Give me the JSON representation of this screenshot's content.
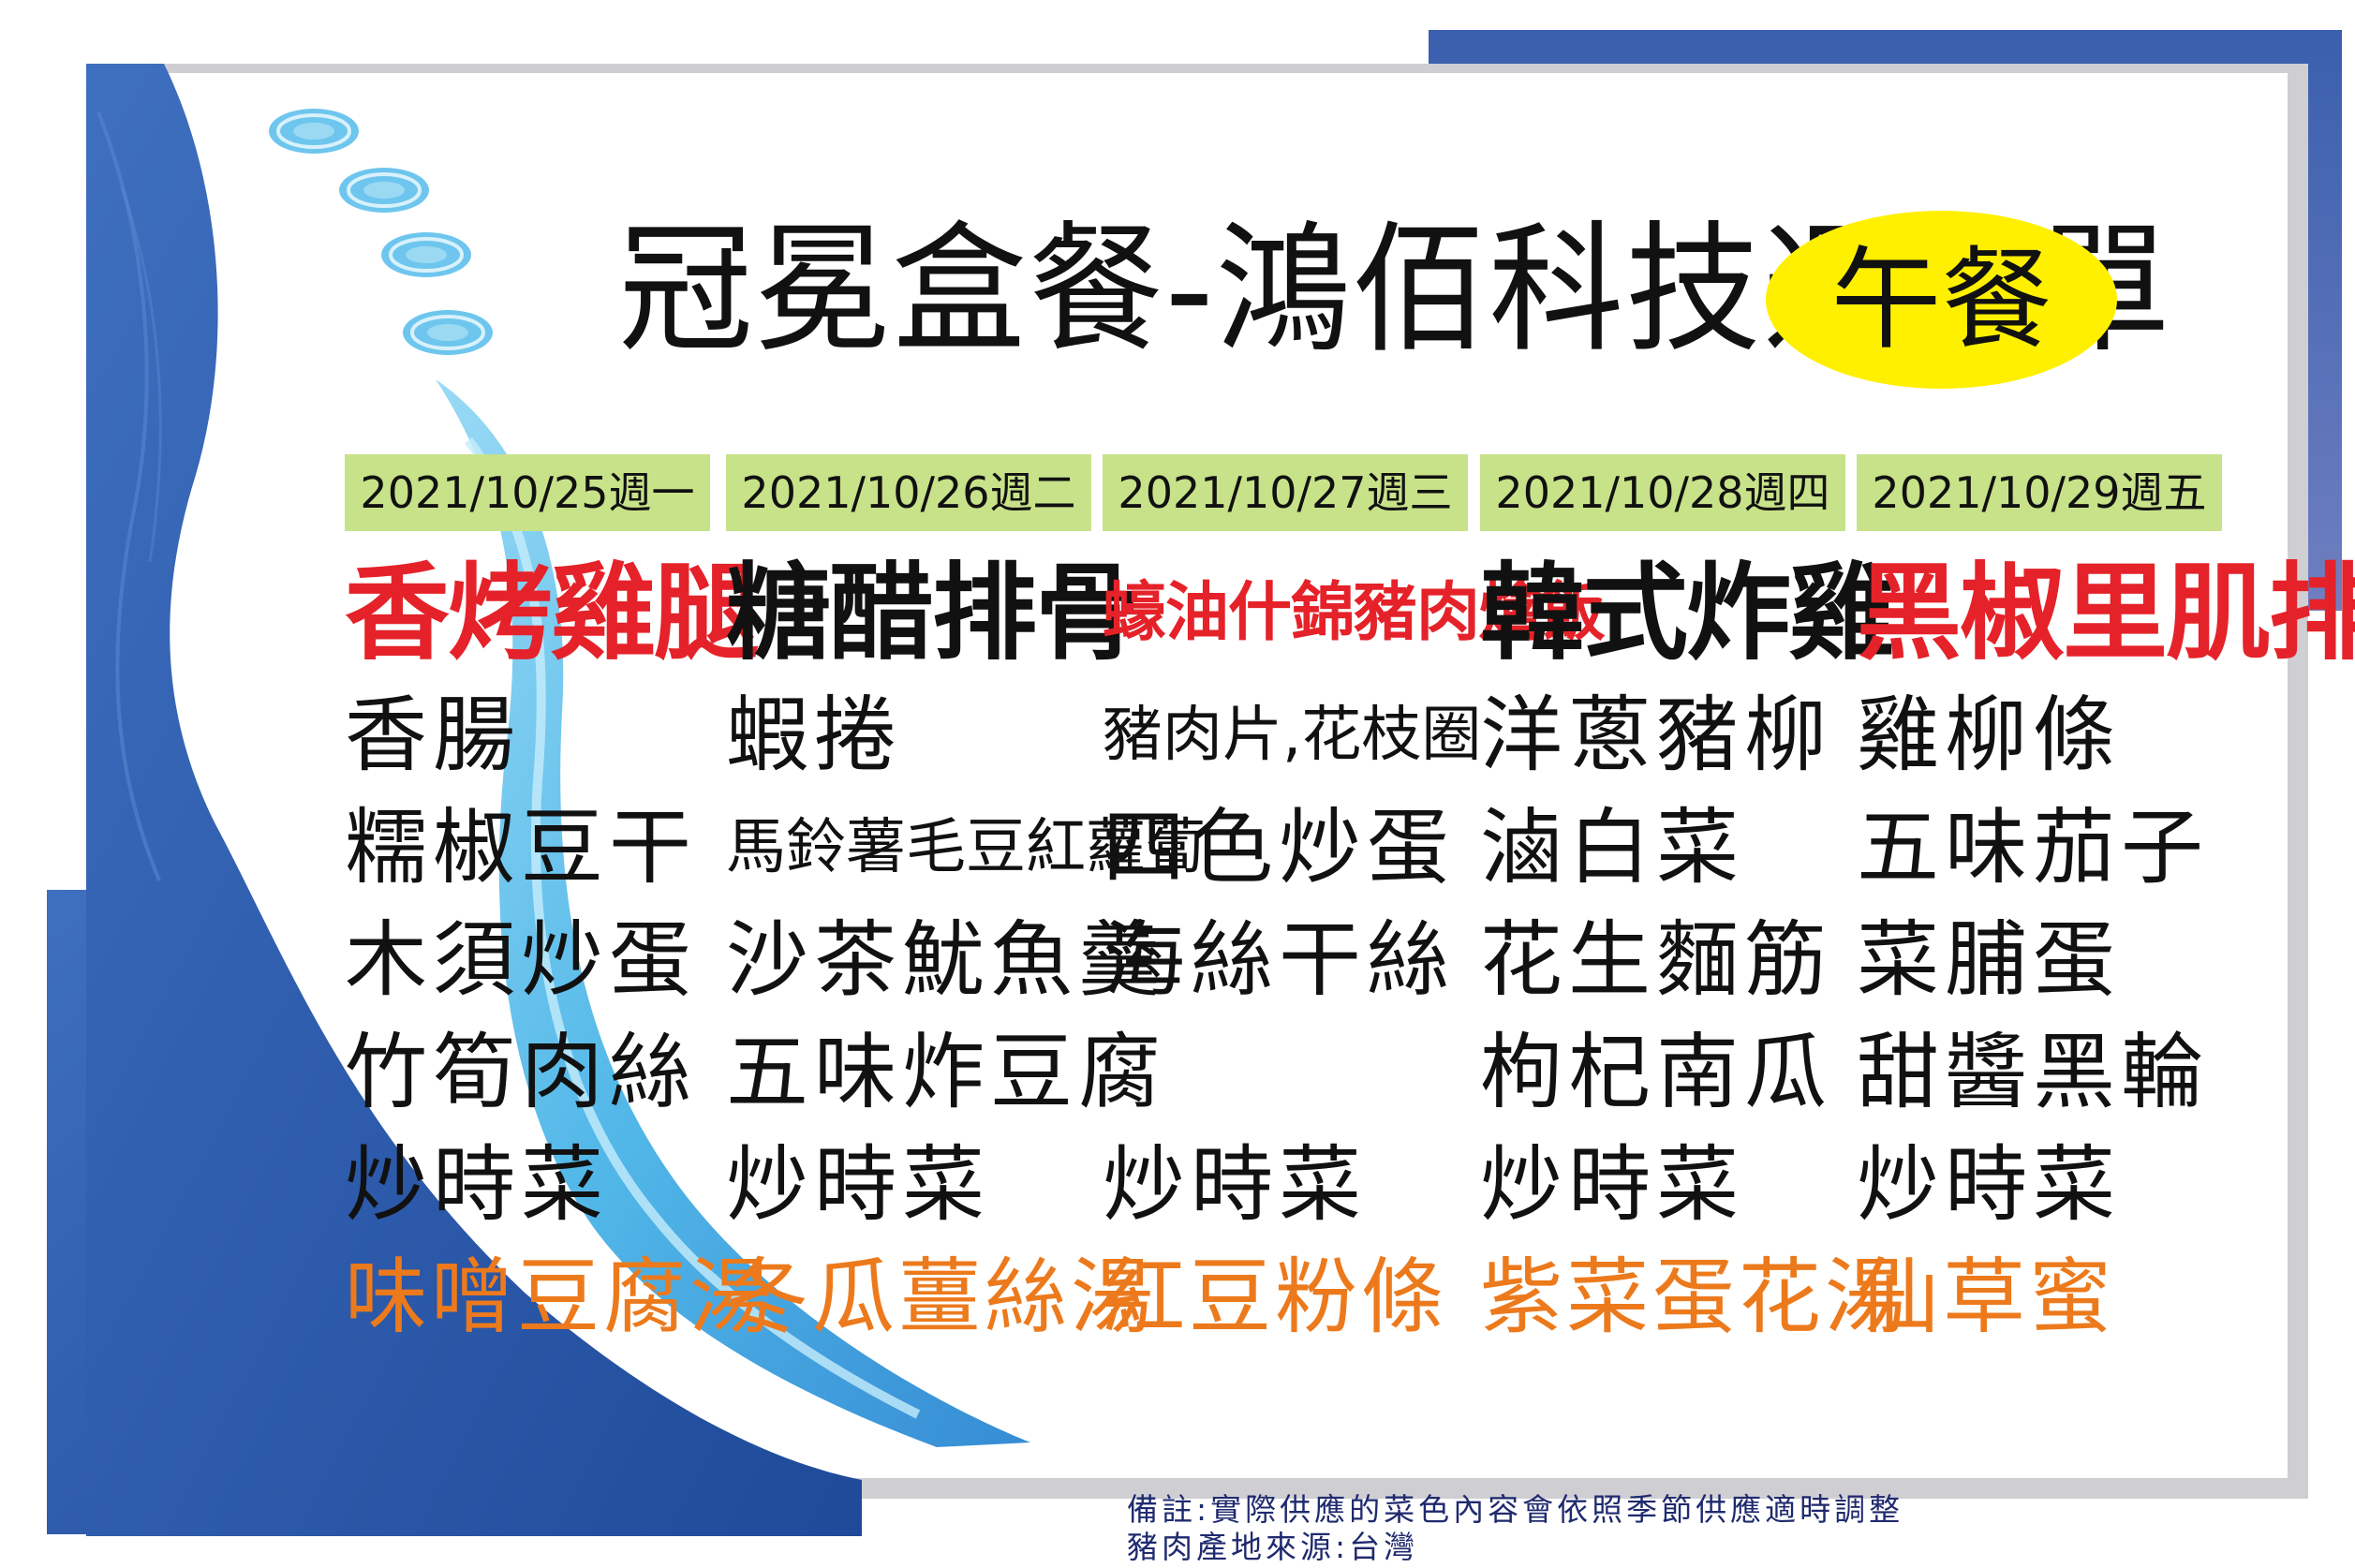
{
  "title": "冠冕盒餐-鴻佰科技週菜單",
  "meal_label": "午餐",
  "days": [
    {
      "date": "2021/10/25週一",
      "main": "香烤雞腿",
      "sides": [
        "香腸",
        "糯椒豆干",
        "木須炒蛋",
        "竹筍肉絲",
        "炒時菜"
      ],
      "soup": "味噌豆腐湯"
    },
    {
      "date": "2021/10/26週二",
      "main": "糖醋排骨",
      "sides": [
        "蝦捲",
        "馬鈴薯毛豆紅蘿蔔",
        "沙茶魷魚羹",
        "五味炸豆腐",
        "炒時菜"
      ],
      "soup": "冬瓜薑絲湯"
    },
    {
      "date": "2021/10/27週三",
      "main": "蠔油什錦豬肉燴飯",
      "sides": [
        "豬肉片,花枝圈",
        "四色炒蛋",
        "海絲干絲",
        "",
        "炒時菜"
      ],
      "soup": "紅豆粉條"
    },
    {
      "date": "2021/10/28週四",
      "main": "韓式炸雞",
      "sides": [
        "洋蔥豬柳",
        "滷白菜",
        "花生麵筋",
        "枸杞南瓜",
        "炒時菜"
      ],
      "soup": "紫菜蛋花湯"
    },
    {
      "date": "2021/10/29週五",
      "main": "黑椒里肌排",
      "sides": [
        "雞柳條",
        "五味茄子",
        "菜脯蛋",
        "甜醬黑輪",
        "炒時菜"
      ],
      "soup": "仙草蜜"
    }
  ],
  "notes": [
    "備註:實際供應的菜色內容會依照季節供應適時調整",
    "豬肉產地來源:台灣"
  ],
  "colors": {
    "accent_red": "#e52229",
    "soup_orange": "#ec7a1c",
    "date_bar_green": "#c8e28a",
    "badge_yellow": "#fff000",
    "frame_blue": "#2d58a8",
    "wave_light_blue": "#6ec6ee"
  }
}
